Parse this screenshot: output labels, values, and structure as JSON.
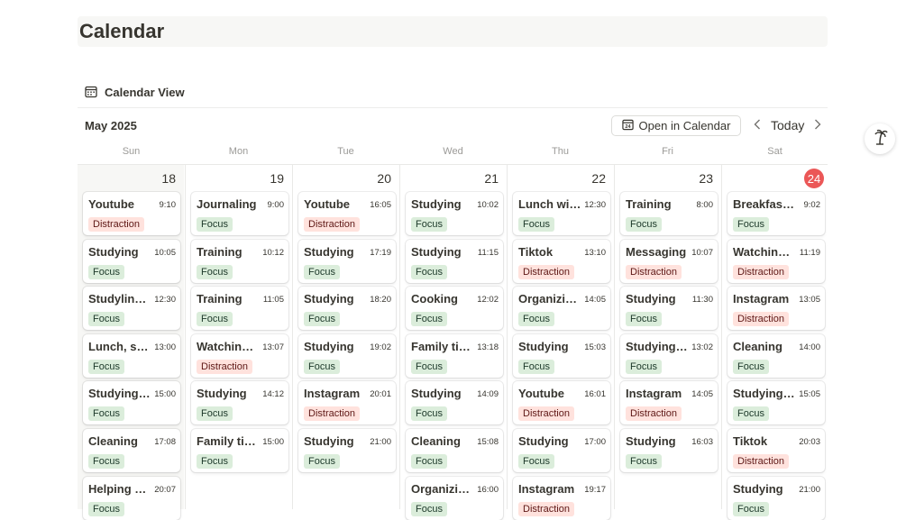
{
  "page": {
    "title": "Calendar"
  },
  "view": {
    "label": "Calendar View",
    "icon": "calendar-view-icon"
  },
  "toolbar": {
    "month": "May 2025",
    "open_label": "Open in Calendar",
    "today_label": "Today",
    "prev_icon": "chevron-left-icon",
    "next_icon": "chevron-right-icon"
  },
  "colors": {
    "focus_bg": "#dbeddb",
    "distraction_bg": "#ffe2dd",
    "today_badge": "#eb5757"
  },
  "days": [
    {
      "dow": "Sun",
      "date": "18",
      "today": false,
      "events": [
        {
          "name": "Youtube",
          "time": "9:10",
          "tag": "Distraction"
        },
        {
          "name": "Studying",
          "time": "10:05",
          "tag": "Focus"
        },
        {
          "name": "Studyling, …",
          "time": "12:30",
          "tag": "Focus"
        },
        {
          "name": "Lunch, stu…",
          "time": "13:00",
          "tag": "Focus"
        },
        {
          "name": "Studying, …",
          "time": "15:00",
          "tag": "Focus"
        },
        {
          "name": "Cleaning",
          "time": "17:08",
          "tag": "Focus"
        },
        {
          "name": "Helping a …",
          "time": "20:07",
          "tag": "Focus"
        }
      ]
    },
    {
      "dow": "Mon",
      "date": "19",
      "today": false,
      "events": [
        {
          "name": "Journaling",
          "time": "9:00",
          "tag": "Focus"
        },
        {
          "name": "Training",
          "time": "10:12",
          "tag": "Focus"
        },
        {
          "name": "Training",
          "time": "11:05",
          "tag": "Focus"
        },
        {
          "name": "Watching …",
          "time": "13:07",
          "tag": "Distraction"
        },
        {
          "name": "Studying",
          "time": "14:12",
          "tag": "Focus"
        },
        {
          "name": "Family time",
          "time": "15:00",
          "tag": "Focus"
        }
      ]
    },
    {
      "dow": "Tue",
      "date": "20",
      "today": false,
      "events": [
        {
          "name": "Youtube",
          "time": "16:05",
          "tag": "Distraction"
        },
        {
          "name": "Studying",
          "time": "17:19",
          "tag": "Focus"
        },
        {
          "name": "Studying",
          "time": "18:20",
          "tag": "Focus"
        },
        {
          "name": "Studying",
          "time": "19:02",
          "tag": "Focus"
        },
        {
          "name": "Instagram",
          "time": "20:01",
          "tag": "Distraction"
        },
        {
          "name": "Studying",
          "time": "21:00",
          "tag": "Focus"
        }
      ]
    },
    {
      "dow": "Wed",
      "date": "21",
      "today": false,
      "events": [
        {
          "name": "Studying",
          "time": "10:02",
          "tag": "Focus"
        },
        {
          "name": "Studying",
          "time": "11:15",
          "tag": "Focus"
        },
        {
          "name": "Cooking",
          "time": "12:02",
          "tag": "Focus"
        },
        {
          "name": "Family time",
          "time": "13:18",
          "tag": "Focus"
        },
        {
          "name": "Studying",
          "time": "14:09",
          "tag": "Focus"
        },
        {
          "name": "Cleaning",
          "time": "15:08",
          "tag": "Focus"
        },
        {
          "name": "Organizin…",
          "time": "16:00",
          "tag": "Focus"
        }
      ]
    },
    {
      "dow": "Thu",
      "date": "22",
      "today": false,
      "events": [
        {
          "name": "Lunch wit…",
          "time": "12:30",
          "tag": "Focus"
        },
        {
          "name": "Tiktok",
          "time": "13:10",
          "tag": "Distraction"
        },
        {
          "name": "Organizin…",
          "time": "14:05",
          "tag": "Focus"
        },
        {
          "name": "Studying",
          "time": "15:03",
          "tag": "Focus"
        },
        {
          "name": "Youtube",
          "time": "16:01",
          "tag": "Distraction"
        },
        {
          "name": "Studying",
          "time": "17:00",
          "tag": "Focus"
        },
        {
          "name": "Instagram",
          "time": "19:17",
          "tag": "Distraction"
        }
      ]
    },
    {
      "dow": "Fri",
      "date": "23",
      "today": false,
      "events": [
        {
          "name": "Training",
          "time": "8:00",
          "tag": "Focus"
        },
        {
          "name": "Messaging",
          "time": "10:07",
          "tag": "Distraction"
        },
        {
          "name": "Studying",
          "time": "11:30",
          "tag": "Focus"
        },
        {
          "name": "Studying, …",
          "time": "13:02",
          "tag": "Focus"
        },
        {
          "name": "Instagram",
          "time": "14:05",
          "tag": "Distraction"
        },
        {
          "name": "Studying",
          "time": "16:03",
          "tag": "Focus"
        }
      ]
    },
    {
      "dow": "Sat",
      "date": "24",
      "today": true,
      "events": [
        {
          "name": "Breakfast, …",
          "time": "9:02",
          "tag": "Focus"
        },
        {
          "name": "Watching …",
          "time": "11:19",
          "tag": "Distraction"
        },
        {
          "name": "Instagram",
          "time": "13:05",
          "tag": "Distraction"
        },
        {
          "name": "Cleaning",
          "time": "14:00",
          "tag": "Focus"
        },
        {
          "name": "Studying, …",
          "time": "15:05",
          "tag": "Focus"
        },
        {
          "name": "Tiktok",
          "time": "20:03",
          "tag": "Distraction"
        },
        {
          "name": "Studying",
          "time": "21:00",
          "tag": "Focus"
        }
      ]
    }
  ]
}
